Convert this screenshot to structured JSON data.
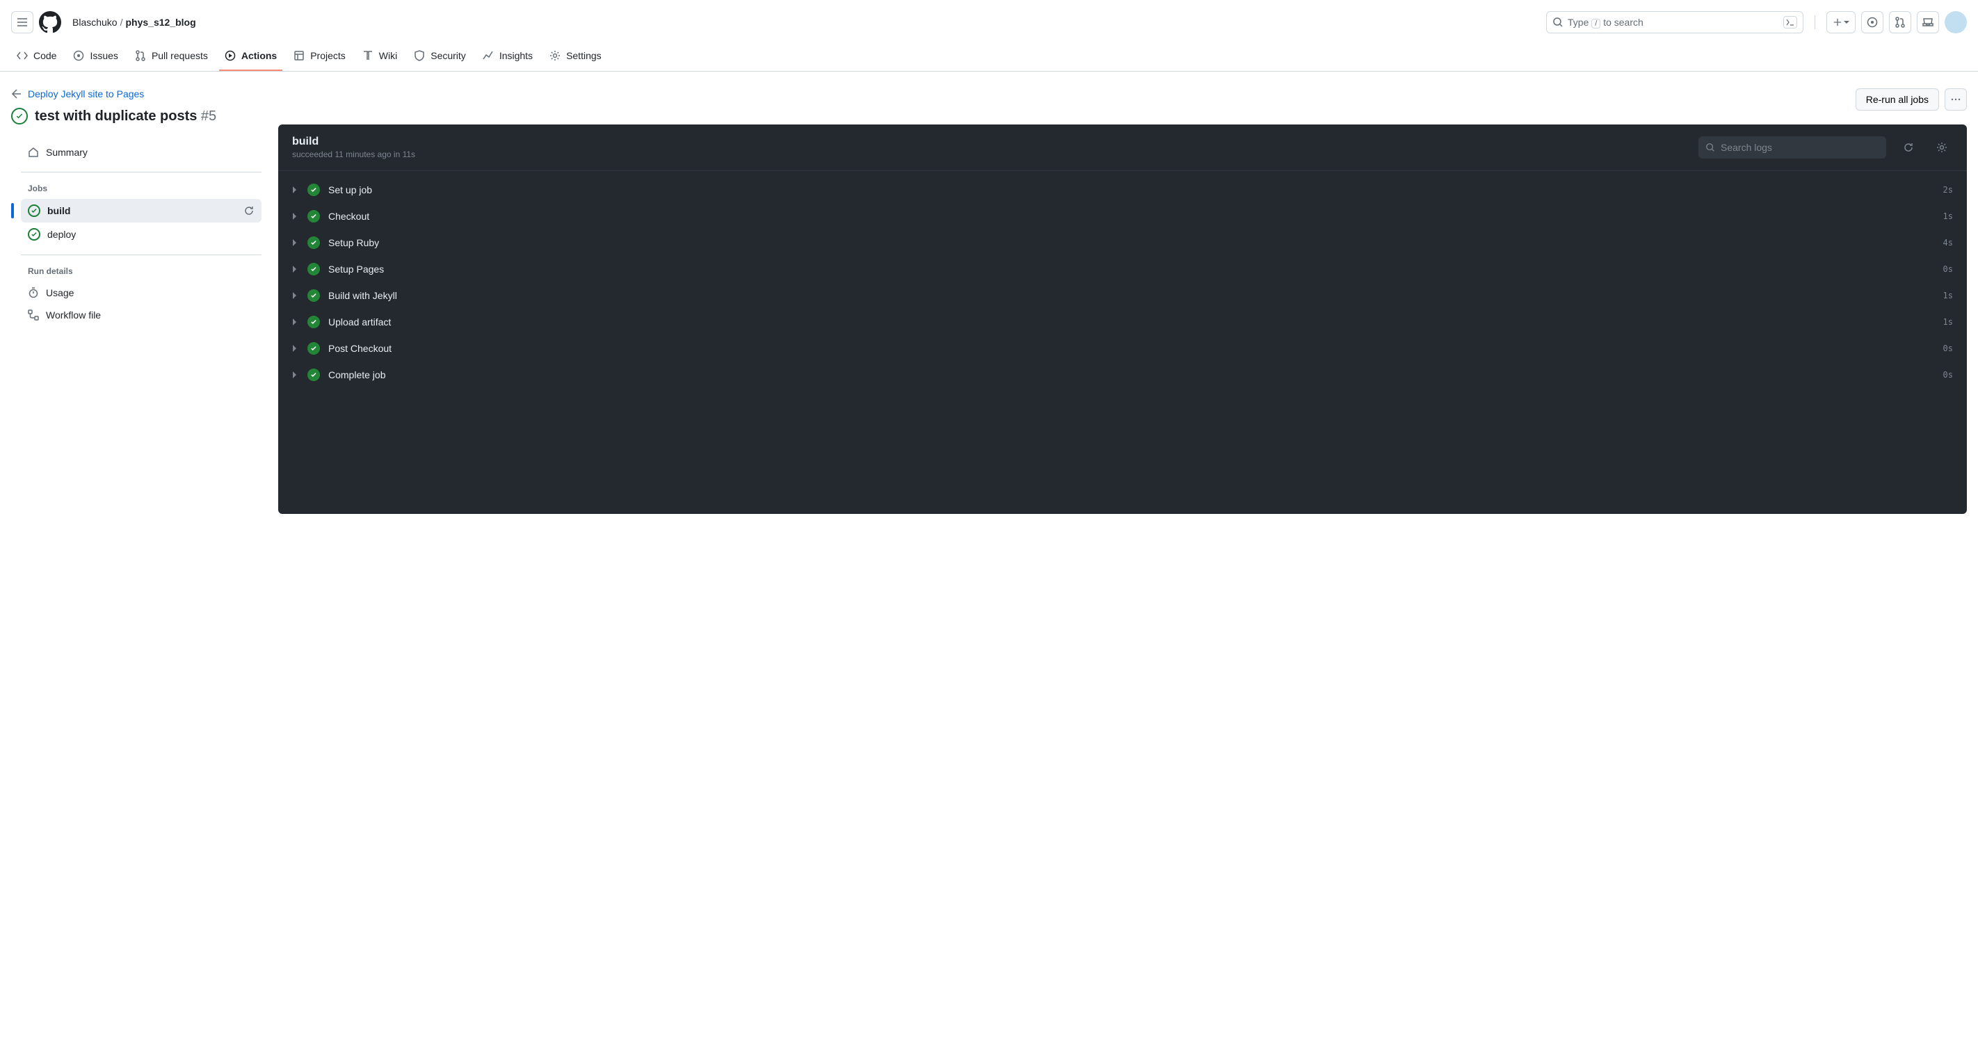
{
  "breadcrumb": {
    "owner": "Blaschuko",
    "repo": "phys_s12_blog"
  },
  "search": {
    "prefix": "Type",
    "kbd": "/",
    "suffix": "to search"
  },
  "nav": {
    "code": "Code",
    "issues": "Issues",
    "pulls": "Pull requests",
    "actions": "Actions",
    "projects": "Projects",
    "wiki": "Wiki",
    "security": "Security",
    "insights": "Insights",
    "settings": "Settings"
  },
  "backlink": "Deploy Jekyll site to Pages",
  "run": {
    "title": "test with duplicate posts",
    "number": "#5"
  },
  "sidebar": {
    "summary": "Summary",
    "jobs_heading": "Jobs",
    "jobs": [
      {
        "label": "build"
      },
      {
        "label": "deploy"
      }
    ],
    "details_heading": "Run details",
    "usage": "Usage",
    "workflow_file": "Workflow file"
  },
  "actions": {
    "rerun": "Re-run all jobs"
  },
  "log": {
    "job_name": "build",
    "meta_prefix": "succeeded",
    "meta_time": "11 minutes ago",
    "meta_in": "in",
    "meta_dur": "11s",
    "search_placeholder": "Search logs",
    "steps": [
      {
        "name": "Set up job",
        "dur": "2s"
      },
      {
        "name": "Checkout",
        "dur": "1s"
      },
      {
        "name": "Setup Ruby",
        "dur": "4s"
      },
      {
        "name": "Setup Pages",
        "dur": "0s"
      },
      {
        "name": "Build with Jekyll",
        "dur": "1s"
      },
      {
        "name": "Upload artifact",
        "dur": "1s"
      },
      {
        "name": "Post Checkout",
        "dur": "0s"
      },
      {
        "name": "Complete job",
        "dur": "0s"
      }
    ]
  }
}
